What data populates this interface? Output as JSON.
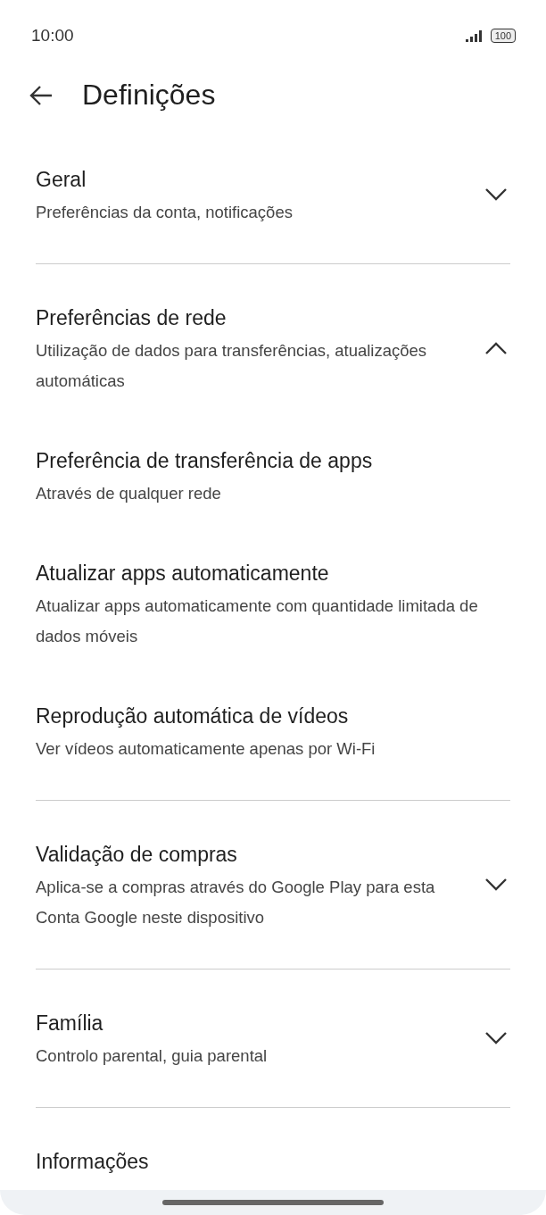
{
  "status_bar": {
    "time": "10:00",
    "battery": "100"
  },
  "header": {
    "title": "Definições"
  },
  "sections": [
    {
      "title": "Geral",
      "subtitle": "Preferências da conta, notificações",
      "expanded": false
    },
    {
      "title": "Preferências de rede",
      "subtitle": "Utilização de dados para transferências, atualizações automáticas",
      "expanded": true,
      "children": [
        {
          "title": "Preferência de transferência de apps",
          "subtitle": "Através de qualquer rede"
        },
        {
          "title": "Atualizar apps automaticamente",
          "subtitle": "Atualizar apps automaticamente com quantidade limitada de dados móveis"
        },
        {
          "title": "Reprodução automática de vídeos",
          "subtitle": "Ver vídeos automaticamente apenas por Wi-Fi"
        }
      ]
    },
    {
      "title": "Validação de compras",
      "subtitle": "Aplica-se a compras através do Google Play para esta Conta Google neste dispositivo",
      "expanded": false
    },
    {
      "title": "Família",
      "subtitle": "Controlo parental, guia parental",
      "expanded": false
    },
    {
      "title": "Informações"
    }
  ]
}
